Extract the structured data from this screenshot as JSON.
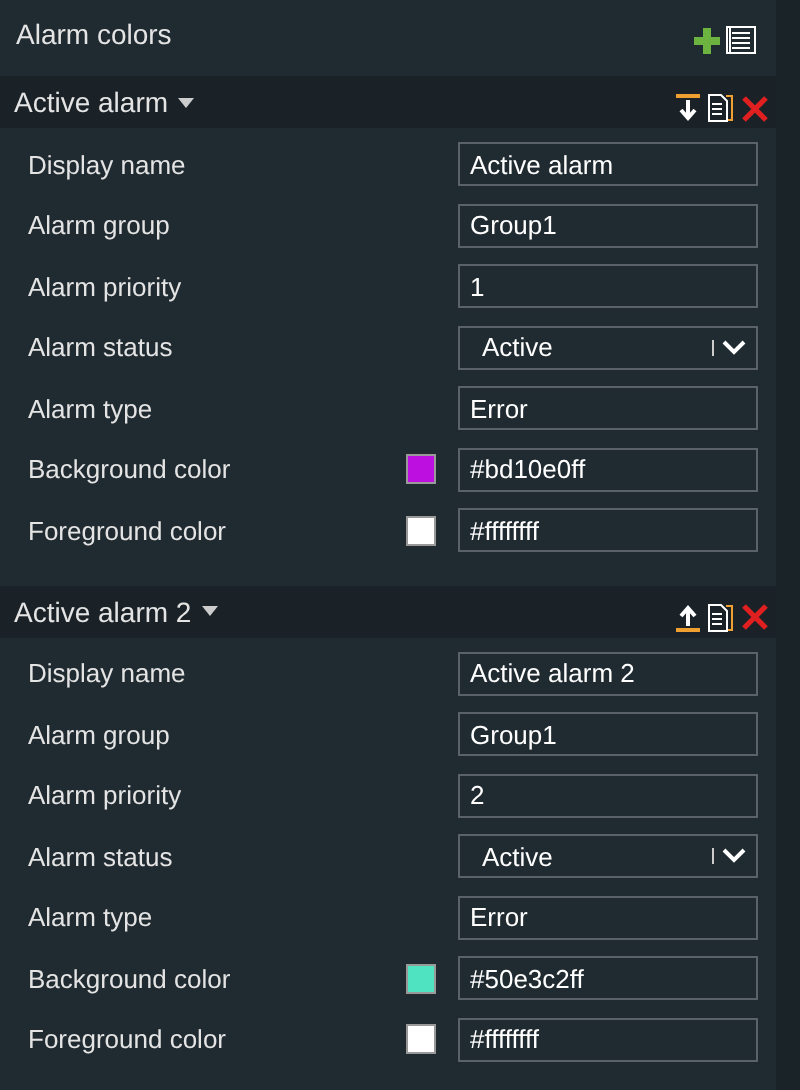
{
  "title": "Alarm colors",
  "alarms": [
    {
      "name": "Active alarm",
      "kind": "movedown",
      "fields": [
        {
          "label": "Display name",
          "kind": "text",
          "value": "Active alarm"
        },
        {
          "label": "Alarm group",
          "kind": "text",
          "value": "Group1"
        },
        {
          "label": "Alarm priority",
          "kind": "text",
          "value": "1"
        },
        {
          "label": "Alarm status",
          "kind": "select",
          "value": "Active"
        },
        {
          "label": "Alarm type",
          "kind": "text",
          "value": "Error"
        },
        {
          "label": "Background color",
          "kind": "color",
          "value": "#bd10e0ff",
          "color": "#bd10e0"
        },
        {
          "label": "Foreground color",
          "kind": "color",
          "value": "#ffffffff",
          "color": "#ffffff"
        }
      ]
    },
    {
      "name": "Active alarm 2",
      "kind": "moveup",
      "fields": [
        {
          "label": "Display name",
          "kind": "text",
          "value": "Active alarm 2"
        },
        {
          "label": "Alarm group",
          "kind": "text",
          "value": "Group1"
        },
        {
          "label": "Alarm priority",
          "kind": "text",
          "value": "2"
        },
        {
          "label": "Alarm status",
          "kind": "select",
          "value": "Active"
        },
        {
          "label": "Alarm type",
          "kind": "text",
          "value": "Error"
        },
        {
          "label": "Background color",
          "kind": "color",
          "value": "#50e3c2ff",
          "color": "#50e3c2"
        },
        {
          "label": "Foreground color",
          "kind": "color",
          "value": "#ffffffff",
          "color": "#ffffff"
        }
      ]
    }
  ]
}
